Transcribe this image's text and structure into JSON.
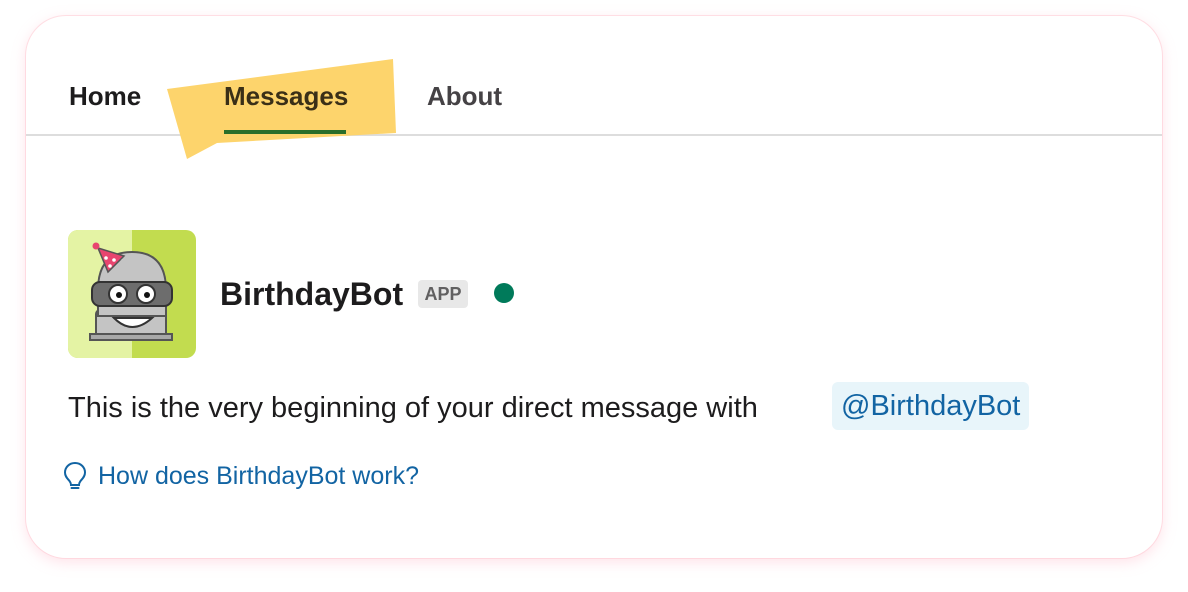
{
  "tabs": [
    {
      "label": "Home"
    },
    {
      "label": "Messages"
    },
    {
      "label": "About"
    }
  ],
  "bot": {
    "name": "BirthdayBot",
    "badge": "APP",
    "status_color": "#007a5a"
  },
  "intro": {
    "text": "This is the very beginning of your direct message with",
    "mention": "@BirthdayBot"
  },
  "help_link": {
    "text": "How does BirthdayBot work?",
    "icon": "lightbulb-icon"
  },
  "colors": {
    "highlight": "#fdd46c",
    "active_underline": "#2a6e2a",
    "link": "#1264a3",
    "avatar_bg": "#c2dc4f"
  }
}
